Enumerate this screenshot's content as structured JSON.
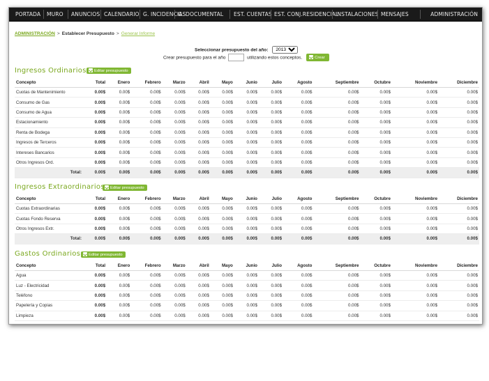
{
  "nav": {
    "items": [
      "PORTADA",
      "MURO",
      "ANUNCIOS",
      "CALENDARIO",
      "G. INCIDENCIAS",
      "G. DOCUMENTAL",
      "EST. CUENTAS",
      "EST. CONJ.RESIDENCIAL",
      "INSTALACIONES",
      "MENSAJES"
    ],
    "right": "ADMINISTRACIÓN"
  },
  "breadcrumb": {
    "root": "ADMINISTRACIÓN",
    "current": "Establecer Presupuesto",
    "link": "Generar Informe",
    "arrow": ">"
  },
  "year_selector": {
    "label": "Seleccionar presupuesto del año:",
    "selected": "2013"
  },
  "create": {
    "prefix": "Crear presupuesto para el año",
    "suffix": "utilizando estos conceptos.",
    "value": "",
    "button": "Crear"
  },
  "edit_button_label": "Editar presupuesto",
  "columns": [
    "Concepto",
    "Total",
    "Enero",
    "Febrero",
    "Marzo",
    "Abril",
    "Mayo",
    "Junio",
    "Julio",
    "Agosto",
    "Septiembre",
    "Octubre",
    "Noviembre",
    "Diciembre"
  ],
  "zero": "0.00$",
  "total_label": "Total:",
  "sections": [
    {
      "title": "Ingresos Ordinarios",
      "rows": [
        "Cuotas de Mantenimiento",
        "Consumo de Gas",
        "Consumo de Agua",
        "Estacionamiento",
        "Renta de Bodega",
        "Ingresos de Terceros",
        "Intereses Bancarios",
        "Otros Ingresos Ord."
      ],
      "has_total": true
    },
    {
      "title": "Ingresos Extraordinarios",
      "rows": [
        "Cuotas Extraordinarias",
        "Cuotas Fondo Reserva",
        "Otros Ingresos Extr."
      ],
      "has_total": true
    },
    {
      "title": "Gastos Ordinarios",
      "rows": [
        "Agua",
        "Luz - Electricidad",
        "Teléfono",
        "Papelería y Copias",
        "Limpieza"
      ],
      "has_total": false
    }
  ],
  "colors": {
    "accent": "#80b733",
    "title": "#7aa81e",
    "nav_bg": "#1a1a1a"
  }
}
